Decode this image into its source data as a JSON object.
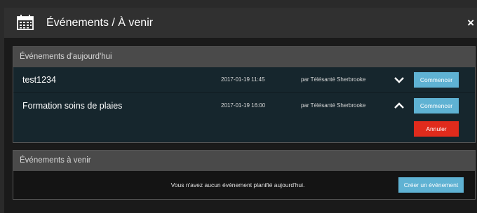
{
  "window": {
    "title": "Événements / À venir",
    "close_label": "×"
  },
  "today_section": {
    "heading": "Événements d'aujourd'hui",
    "events": [
      {
        "name": "test1234",
        "datetime": "2017-01-19 11:45",
        "organizer": "par Télésanté Sherbrooke",
        "start_label": "Commencer",
        "expanded": false
      },
      {
        "name": "Formation soins de plaies",
        "datetime": "2017-01-19 16:00",
        "organizer": "par Télésanté Sherbrooke",
        "start_label": "Commencer",
        "expanded": true,
        "cancel_label": "Annuler"
      }
    ]
  },
  "upcoming_section": {
    "heading": "Événements à venir",
    "empty_message": "Vous n'avez aucun événement planifié aujourd'hui.",
    "create_label": "Créer un événement"
  },
  "colors": {
    "primary_button": "#5fb2d3",
    "danger_button": "#e02b1c",
    "panel_background": "#16262d",
    "section_header": "#4a4a4a"
  }
}
